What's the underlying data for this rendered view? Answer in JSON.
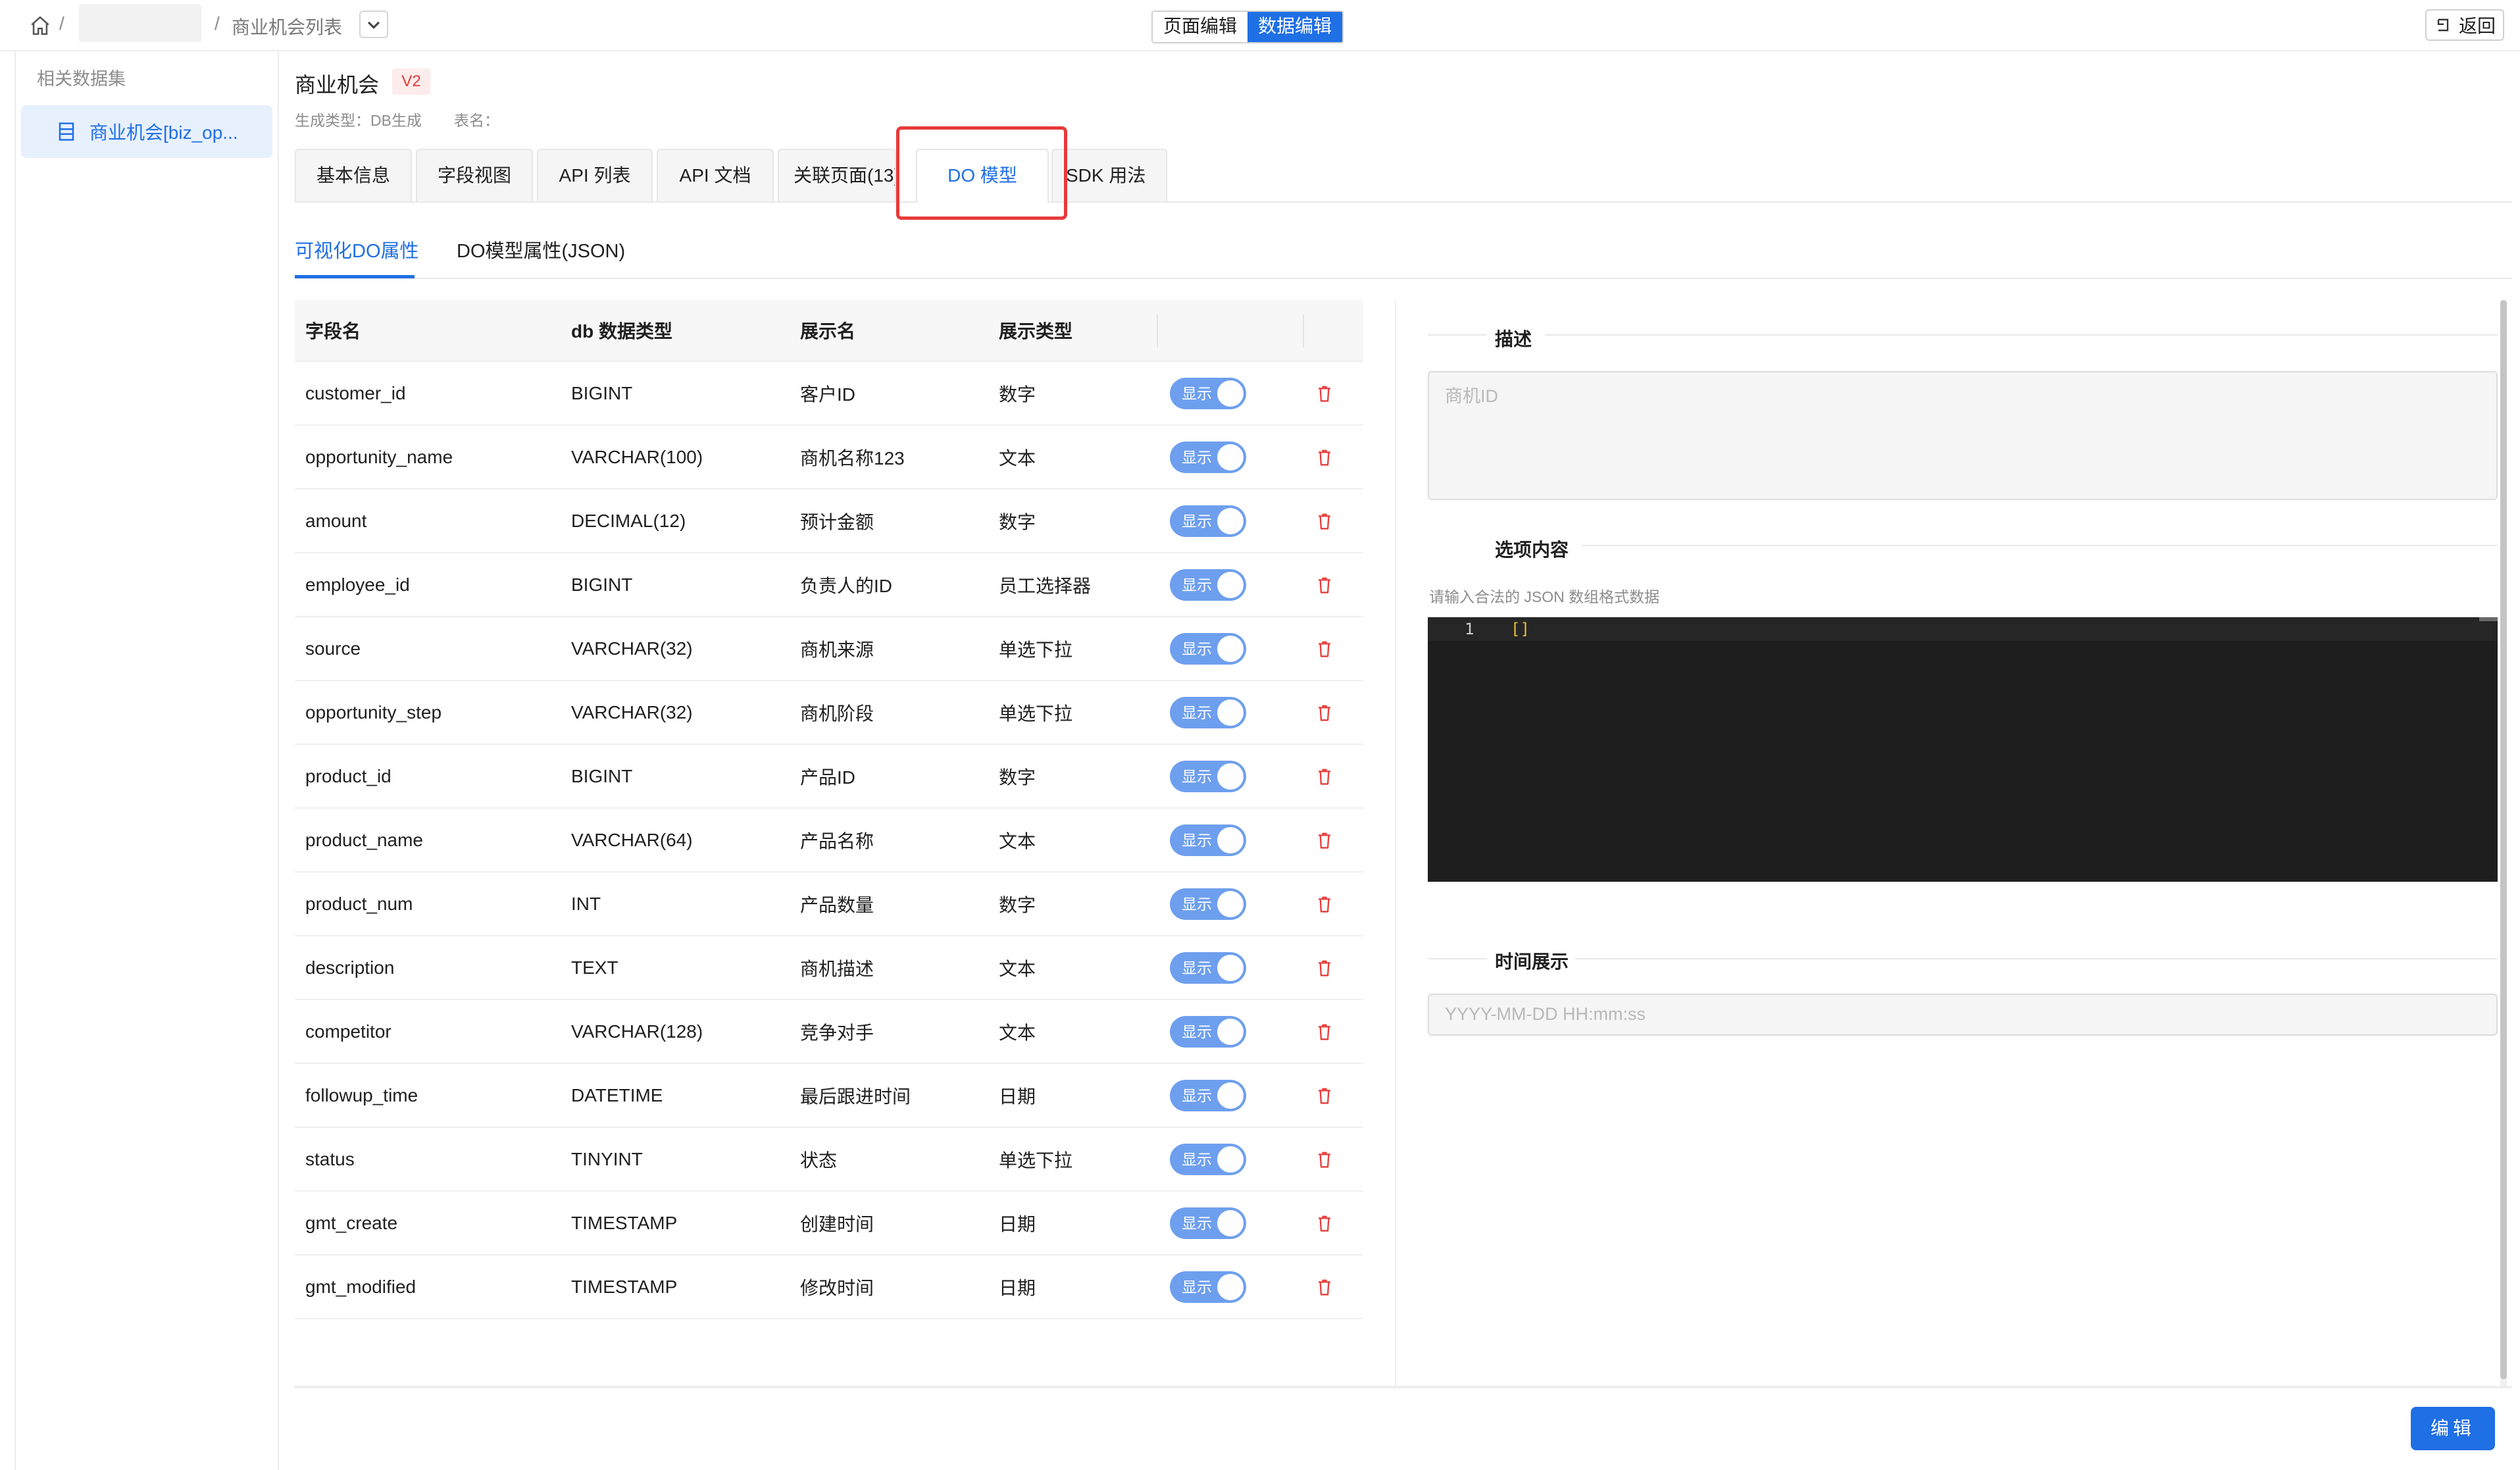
{
  "breadcrumb": {
    "sep": "/",
    "page": "商业机会列表"
  },
  "mode_switch": {
    "page_edit": "页面编辑",
    "data_edit": "数据编辑"
  },
  "back_button": "返回",
  "sidebar": {
    "title": "相关数据集",
    "items": [
      {
        "label": "商业机会[biz_op..."
      }
    ]
  },
  "header": {
    "title": "商业机会",
    "version": "V2",
    "gen_type": "生成类型：DB生成",
    "table_name": "表名："
  },
  "tabs": [
    {
      "label": "基本信息"
    },
    {
      "label": "字段视图"
    },
    {
      "label": "API 列表"
    },
    {
      "label": "API 文档"
    },
    {
      "label": "关联页面(13)"
    },
    {
      "label": "DO 模型"
    },
    {
      "label": "SDK 用法"
    }
  ],
  "subtabs": {
    "visual": "可视化DO属性",
    "json": "DO模型属性(JSON)"
  },
  "table": {
    "columns": [
      "字段名",
      "db 数据类型",
      "展示名",
      "展示类型"
    ],
    "toggle_label": "显示",
    "rows": [
      {
        "field": "customer_id",
        "db_type": "BIGINT",
        "display_name": "客户ID",
        "display_type": "数字"
      },
      {
        "field": "opportunity_name",
        "db_type": "VARCHAR(100)",
        "display_name": "商机名称123",
        "display_type": "文本"
      },
      {
        "field": "amount",
        "db_type": "DECIMAL(12)",
        "display_name": "预计金额",
        "display_type": "数字"
      },
      {
        "field": "employee_id",
        "db_type": "BIGINT",
        "display_name": "负责人的ID",
        "display_type": "员工选择器"
      },
      {
        "field": "source",
        "db_type": "VARCHAR(32)",
        "display_name": "商机来源",
        "display_type": "单选下拉"
      },
      {
        "field": "opportunity_step",
        "db_type": "VARCHAR(32)",
        "display_name": "商机阶段",
        "display_type": "单选下拉"
      },
      {
        "field": "product_id",
        "db_type": "BIGINT",
        "display_name": "产品ID",
        "display_type": "数字"
      },
      {
        "field": "product_name",
        "db_type": "VARCHAR(64)",
        "display_name": "产品名称",
        "display_type": "文本"
      },
      {
        "field": "product_num",
        "db_type": "INT",
        "display_name": "产品数量",
        "display_type": "数字"
      },
      {
        "field": "description",
        "db_type": "TEXT",
        "display_name": "商机描述",
        "display_type": "文本"
      },
      {
        "field": "competitor",
        "db_type": "VARCHAR(128)",
        "display_name": "竞争对手",
        "display_type": "文本"
      },
      {
        "field": "followup_time",
        "db_type": "DATETIME",
        "display_name": "最后跟进时间",
        "display_type": "日期"
      },
      {
        "field": "status",
        "db_type": "TINYINT",
        "display_name": "状态",
        "display_type": "单选下拉"
      },
      {
        "field": "gmt_create",
        "db_type": "TIMESTAMP",
        "display_name": "创建时间",
        "display_type": "日期"
      },
      {
        "field": "gmt_modified",
        "db_type": "TIMESTAMP",
        "display_name": "修改时间",
        "display_type": "日期"
      }
    ]
  },
  "panel": {
    "desc_title": "描述",
    "desc_placeholder": "商机ID",
    "options_title": "选项内容",
    "options_hint": "请输入合法的 JSON 数组格式数据",
    "editor_line": "1",
    "editor_code": "[]",
    "time_title": "时间展示",
    "time_placeholder": "YYYY-MM-DD HH:mm:ss"
  },
  "edit_button": "编辑",
  "colors": {
    "primary": "#1f6fe5",
    "danger": "#e83a3a",
    "toggle": "#6e9fee"
  }
}
